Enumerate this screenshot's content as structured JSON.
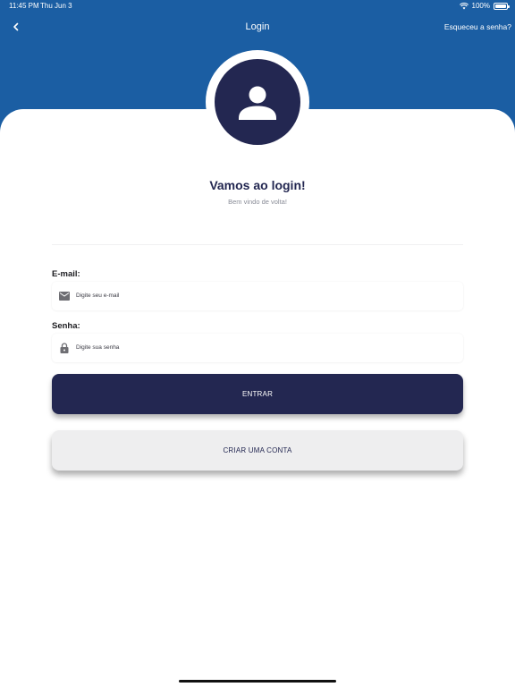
{
  "status_bar": {
    "time": "11:45 PM",
    "date": "Thu Jun 3",
    "battery": "100%"
  },
  "nav": {
    "title": "Login",
    "forgot_password": "Esqueceu a senha?",
    "back_icon": "chevron-left-icon"
  },
  "main": {
    "avatar_icon": "user-icon",
    "heading": "Vamos ao login!",
    "subheading": "Bem vindo de volta!"
  },
  "form": {
    "email": {
      "label": "E-mail:",
      "placeholder": "Digite seu e-mail",
      "icon": "mail-icon"
    },
    "password": {
      "label": "Senha:",
      "placeholder": "Digite sua senha",
      "icon": "lock-icon"
    },
    "submit_label": "ENTRAR",
    "create_account_label": "CRIAR UMA CONTA"
  },
  "colors": {
    "header": "#1b5ea3",
    "primary": "#232751",
    "secondary_button": "#eeeeef"
  }
}
